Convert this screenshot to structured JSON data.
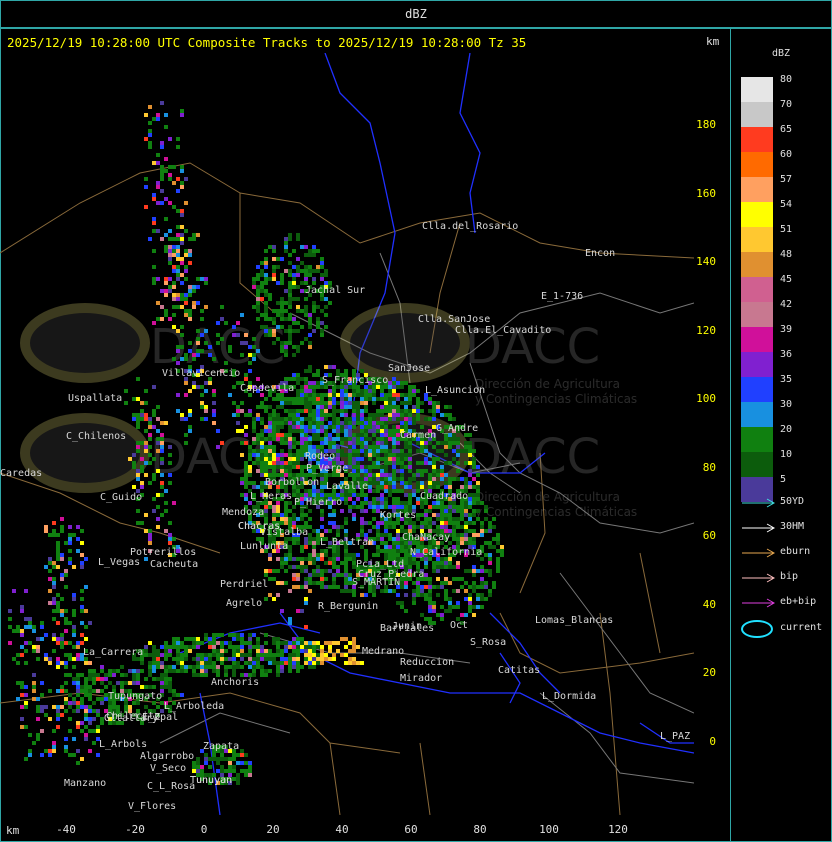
{
  "top_title": "dBZ",
  "header": "2025/12/19 10:28:00 UTC Composite Tracks to 2025/12/19 10:28:00 Tz 35",
  "km_label": "km",
  "legend": {
    "title": "dBZ",
    "levels": [
      {
        "label": "80",
        "color": "#e6e6e6"
      },
      {
        "label": "70",
        "color": "#c8c8c8"
      },
      {
        "label": "65",
        "color": "#ff3b1f"
      },
      {
        "label": "60",
        "color": "#ff6a00"
      },
      {
        "label": "57",
        "color": "#ffa060"
      },
      {
        "label": "54",
        "color": "#ffff00"
      },
      {
        "label": "51",
        "color": "#ffc830"
      },
      {
        "label": "48",
        "color": "#e09030"
      },
      {
        "label": "45",
        "color": "#d06090"
      },
      {
        "label": "42",
        "color": "#c87890"
      },
      {
        "label": "39",
        "color": "#d0109a"
      },
      {
        "label": "36",
        "color": "#8020d0"
      },
      {
        "label": "35",
        "color": "#2040ff"
      },
      {
        "label": "30",
        "color": "#1890e0"
      },
      {
        "label": "20",
        "color": "#108010"
      },
      {
        "label": "10",
        "color": "#0c5c0c"
      },
      {
        "label": "5",
        "color": "#4a3a9a"
      }
    ],
    "tracks": [
      {
        "label": "50YD",
        "color": "#40e0e0"
      },
      {
        "label": "30HM",
        "color": "#ffffff"
      },
      {
        "label": "eburn",
        "color": "#e8a850"
      },
      {
        "label": "bip",
        "color": "#ffc0c0"
      },
      {
        "label": "eb+bip",
        "color": "#e040e0"
      }
    ],
    "current_label": "current"
  },
  "axes": {
    "y_ticks": [
      "180",
      "160",
      "140",
      "120",
      "100",
      "80",
      "60",
      "40",
      "20",
      "0"
    ],
    "x_ticks": [
      "-40",
      "-20",
      "0",
      "20",
      "40",
      "60",
      "80",
      "100",
      "120"
    ]
  },
  "places": [
    "Clla.del_Rosario",
    "Encon",
    "E_1-736",
    "Clla.SanJose",
    "Clla.El_Cavadito",
    "Jachal Sur",
    "Villavicencio",
    "S_Francisco",
    "SanJose",
    "L_Asuncion",
    "Uspallata",
    "C_Chilenos",
    "Carmen",
    "G_Andre",
    "Caredas",
    "Capdevila",
    "P_Verge",
    "Rodeo",
    "Borbollon",
    "C_Guido",
    "P_Hierro",
    "L_Heras",
    "Chacras",
    "Mendoza",
    "Lavalle",
    "Kortes",
    "Cuadrado",
    "Lunlunta",
    "Chacras",
    "Potrerillos",
    "L_Vegas",
    "Cacheuta",
    "Perdriel",
    "Agrelo",
    "L_Beltran",
    "Vistalba",
    "Tupungato",
    "L_Arboleda",
    "Chilecito",
    "Anchoris",
    "Gltallary",
    "E_Zpal",
    "Tunuyan",
    "L_Arbols",
    "Zapata",
    "Algarrobo",
    "V_Seco",
    "Manzano",
    "C_L_Rosa",
    "V_Flores",
    "La_Carrera",
    "Lomas_Blancas",
    "Catitas",
    "L_Dormida",
    "L_PAZ",
    "Mirador",
    "Oct",
    "Junin",
    "S_MARTIN",
    "R_Bergunin",
    "Medrano",
    "Barriales",
    "Tunuyan",
    "N_California",
    "Cruz_Piedra",
    "Reduccion",
    "S_Rosa",
    "Pcia_Ltd",
    "ChaNacay"
  ],
  "watermark": {
    "name": "DACC",
    "line1": "Dirección de Agricultura",
    "line2": "y Contingencias Climáticas"
  }
}
